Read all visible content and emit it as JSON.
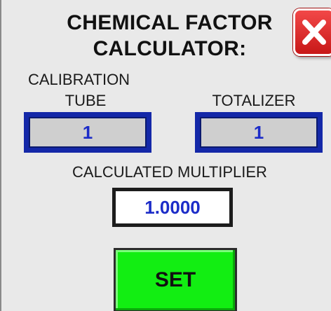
{
  "header": {
    "title_line1": "CHEMICAL FACTOR",
    "title_line2": "CALCULATOR:"
  },
  "close_button": {
    "icon": "close-icon",
    "color": "#e02a2a"
  },
  "calibration_tube": {
    "label_line1": "CALIBRATION",
    "label_line2": "TUBE",
    "value": "1"
  },
  "totalizer": {
    "label": "TOTALIZER",
    "value": "1"
  },
  "calculated_multiplier": {
    "label": "CALCULATED MULTIPLIER",
    "value": "1.0000"
  },
  "set_button": {
    "label": "SET",
    "color": "#12ee12"
  },
  "colors": {
    "field_border": "#1428a8",
    "value_text": "#1c2cc8",
    "background": "#e9e9e9"
  }
}
